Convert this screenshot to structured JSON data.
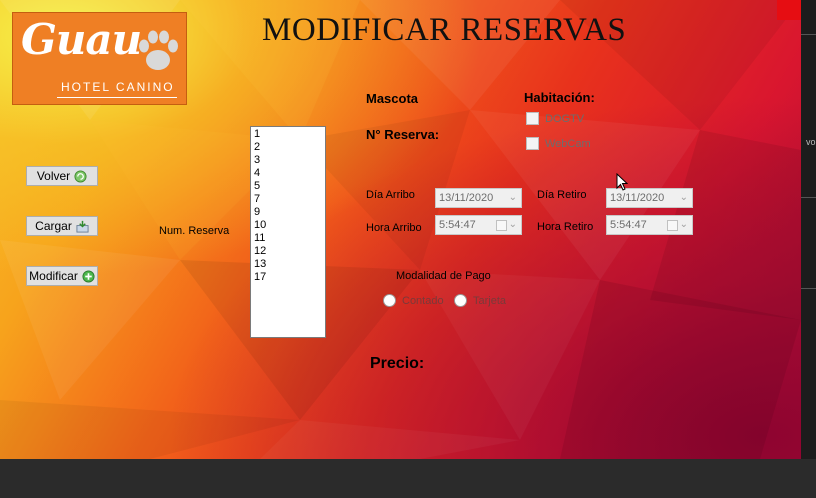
{
  "form": {
    "title": "MODIFICAR RESERVAS",
    "logo": {
      "brand": "Guau",
      "subtitle": "HOTEL CANINO"
    }
  },
  "buttons": {
    "volver": {
      "label": "Volver",
      "icon": "refresh-icon"
    },
    "cargar": {
      "label": "Cargar",
      "icon": "load-icon"
    },
    "modificar": {
      "label": "Modificar",
      "icon": "add-circle-icon"
    }
  },
  "num_reserva": {
    "label": "Num. Reserva",
    "items": [
      "1",
      "2",
      "3",
      "4",
      "5",
      "7",
      "9",
      "10",
      "11",
      "12",
      "13",
      "17"
    ]
  },
  "details": {
    "mascota_label": "Mascota",
    "reserva_label": "N° Reserva:",
    "habitacion_label": "Habitación:",
    "options": {
      "dogtv": "DOGTV",
      "webcam": "WebCam"
    },
    "dia_arribo_label": "Día Arribo",
    "dia_arribo_value": "13/11/2020",
    "dia_retiro_label": "Día Retiro",
    "dia_retiro_value": "13/11/2020",
    "hora_arribo_label": "Hora Arribo",
    "hora_arribo_value": "5:54:47",
    "hora_retiro_label": "Hora Retiro",
    "hora_retiro_value": "5:54:47",
    "pago_label": "Modalidad de Pago",
    "pago_options": {
      "contado": "Contado",
      "tarjeta": "Tarjeta"
    },
    "precio_label": "Precio:"
  },
  "side": {
    "edge_text": "vo"
  },
  "colors": {
    "logo_orange": "#ef7f24",
    "gradient_start": "#f6f24a",
    "gradient_end": "#a30a36"
  }
}
